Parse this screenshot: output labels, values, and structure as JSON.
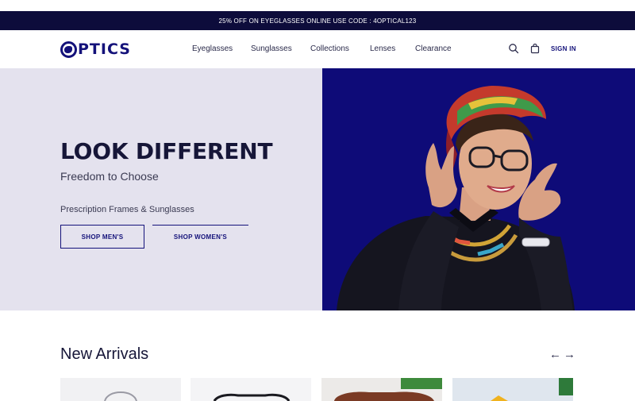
{
  "promo": {
    "text": "25% OFF ON EYEGLASSES ONLINE USE CODE : 4OPTICAL123"
  },
  "header": {
    "logo_text": "PTICS",
    "menu": [
      "Eyeglasses",
      "Sunglasses",
      "Collections",
      "Lenses",
      "Clearance"
    ],
    "search_icon": "search-icon",
    "bag_icon": "shopping-bag-icon",
    "signin_label": "SIGN IN"
  },
  "hero": {
    "headline": "LOOK DIFFERENT",
    "tagline": "Freedom to Choose",
    "subline": "Prescription Frames & Sunglasses",
    "buttons": {
      "men": "SHOP MEN'S",
      "women": "SHOP WOMEN'S"
    },
    "image": "woman-with-glasses"
  },
  "new_arrivals": {
    "title": "New Arrivals",
    "prev_icon": "arrow-left-icon",
    "next_icon": "arrow-right-icon",
    "prev_label": "←",
    "next_label": "→"
  },
  "colors": {
    "brand": "#14127a",
    "promo_bg": "#0d0c3b",
    "hero_left_bg": "#e4e2ee",
    "hero_right_bg": "#0e0b78"
  }
}
